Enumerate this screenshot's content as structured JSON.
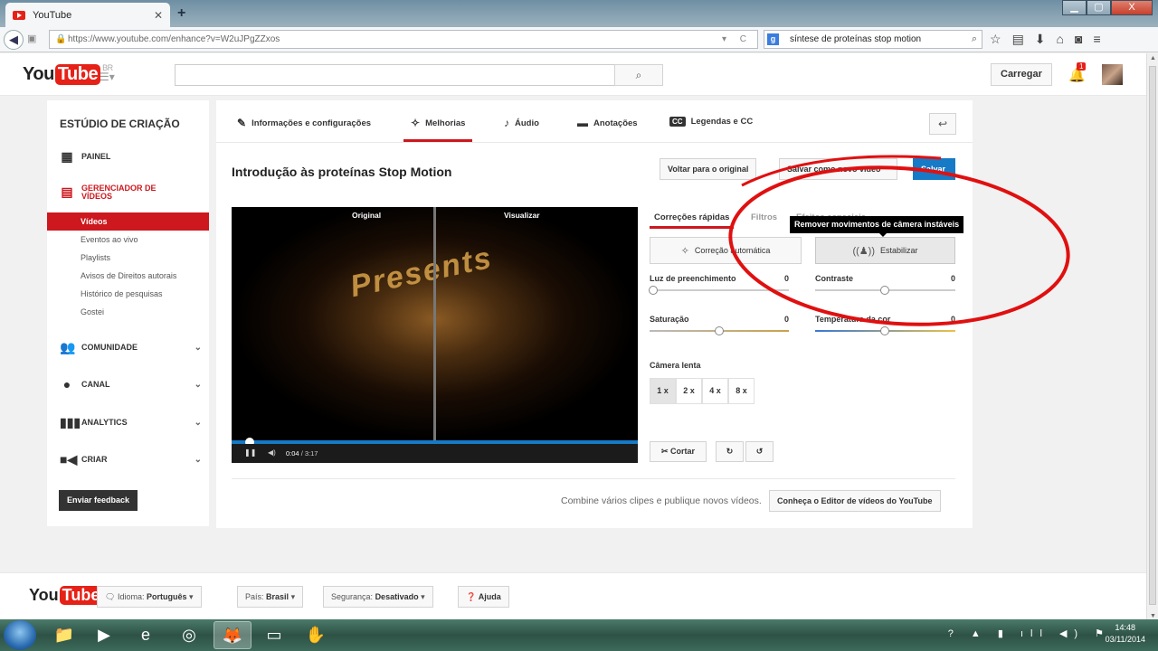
{
  "browser": {
    "tab_title": "YouTube",
    "tab_close": "✕",
    "new_tab": "+",
    "url": "https://www.youtube.com/enhance?v=W2uJPgZZxos",
    "search_query": "síntese de proteínas stop motion",
    "window_buttons": [
      "▁",
      "▢",
      "X"
    ]
  },
  "header": {
    "logo_you": "You",
    "logo_tube": "Tube",
    "region": "BR",
    "search_placeholder": "",
    "upload_label": "Carregar",
    "notification_count": "1"
  },
  "sidebar": {
    "title": "ESTÚDIO DE CRIAÇÃO",
    "sections": {
      "painel": "PAINEL",
      "gerenciador": "GERENCIADOR DE VÍDEOS",
      "comunidade": "COMUNIDADE",
      "canal": "CANAL",
      "analytics": "ANALYTICS",
      "criar": "CRIAR"
    },
    "items": [
      "Vídeos",
      "Eventos ao vivo",
      "Playlists",
      "Avisos de Direitos autorais",
      "Histórico de pesquisas",
      "Gostei"
    ],
    "feedback_label": "Enviar feedback"
  },
  "editor": {
    "tabs": [
      "Informações e configurações",
      "Melhorias",
      "Áudio",
      "Anotações",
      "Legendas e CC"
    ],
    "active_tab": "Melhorias",
    "video_title": "Introdução às proteínas Stop Motion",
    "revert_label": "Voltar para o original",
    "save_as_label": "Salvar como novo vídeo",
    "save_label": "Salvar",
    "player": {
      "label_original": "Original",
      "label_preview": "Visualizar",
      "overlay": "Presents",
      "time_current": "0:04",
      "time_total": "3:17",
      "progress_fraction": 0.02
    },
    "subtabs": [
      "Correções rápidas",
      "Filtros",
      "Efeitos especiais"
    ],
    "tooltip": "Remover movimentos de câmera instáveis",
    "auto_fix_label": "Correção automática",
    "stabilize_label": "Estabilizar",
    "sliders": {
      "fill_light": {
        "label": "Luz de preenchimento",
        "value": "0"
      },
      "contrast": {
        "label": "Contraste",
        "value": "0"
      },
      "saturation": {
        "label": "Saturação",
        "value": "0"
      },
      "temperature": {
        "label": "Temperatura da cor",
        "value": "0"
      }
    },
    "slow_motion_label": "Câmera lenta",
    "speeds": [
      "1 x",
      "2 x",
      "4 x",
      "8 x"
    ],
    "trim_label": "Cortar",
    "combine_text": "Combine vários clipes e publique novos vídeos.",
    "editor_link": "Conheça o Editor de vídeos do YouTube"
  },
  "footer": {
    "language_label": "Idioma:",
    "language_value": "Português",
    "country_label": "País:",
    "country_value": "Brasil",
    "safety_label": "Segurança:",
    "safety_value": "Desativado",
    "help_label": "Ajuda"
  },
  "taskbar": {
    "time": "14:48",
    "date": "03/11/2014"
  },
  "colors": {
    "accent_red": "#cc181e",
    "save_blue": "#167ac6",
    "annotation_red": "#e01010"
  }
}
